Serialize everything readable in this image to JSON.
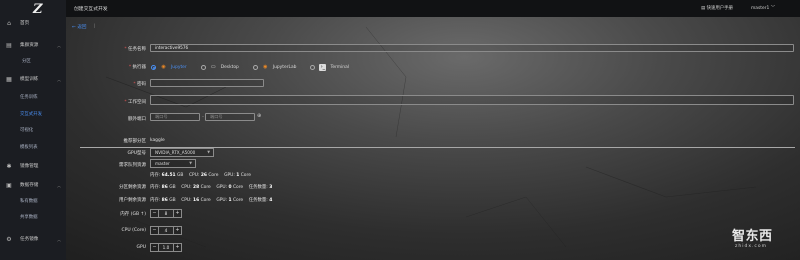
{
  "sidebar": {
    "logo": "Z",
    "items": [
      {
        "label": "首页",
        "icon": "home-icon"
      },
      {
        "label": "集群资源",
        "icon": "server-icon"
      },
      {
        "label": "分区",
        "icon": ""
      },
      {
        "label": "模型训练",
        "icon": "model-icon"
      },
      {
        "label": "任务训练",
        "icon": ""
      },
      {
        "label": "交互式开发",
        "icon": ""
      },
      {
        "label": "可视化",
        "icon": ""
      },
      {
        "label": "模板列表",
        "icon": ""
      },
      {
        "label": "镜像管理",
        "icon": "image-icon"
      },
      {
        "label": "数据存储",
        "icon": "storage-icon"
      },
      {
        "label": "私有数据",
        "icon": ""
      },
      {
        "label": "共享数据",
        "icon": ""
      },
      {
        "label": "任务镜像",
        "icon": "task-icon"
      }
    ]
  },
  "topbar": {
    "breadcrumb": "创建交互式开发",
    "manual_label": "快速用户手册",
    "user": "master1"
  },
  "form": {
    "back": "返回",
    "task_name_label": "任务名称",
    "task_name_value": "interactive9576",
    "executor_label": "执行器",
    "executors": [
      "Jupyter",
      "Desktop",
      "JupyterLab",
      "Terminal"
    ],
    "password_label": "密码",
    "workdir_label": "工作空间",
    "ports_label": "额外端口",
    "port_placeholder": "端口号",
    "partition_label": "推荐部分区",
    "partition_value": "kaggle",
    "gpu_type_label": "GPU型号",
    "gpu_type_value": "NVIDIA_RTX_A5000",
    "queue_label": "需求队列资源",
    "queue_value": "master",
    "res_line1": {
      "mem_label": "内存:",
      "mem": "64.51",
      "mem_unit": "GB",
      "cpu_label": "CPU:",
      "cpu": "26",
      "cpu_unit": "Core",
      "gpu_label": "GPU:",
      "gpu": "1",
      "gpu_unit": "Core"
    },
    "partition_quota_label": "分区剩余资源",
    "res_line2": {
      "mem_label": "内存:",
      "mem": "86",
      "mem_unit": "GB",
      "cpu_label": "CPU:",
      "cpu": "28",
      "cpu_unit": "Core",
      "gpu_label": "GPU:",
      "gpu": "0",
      "gpu_unit": "Core",
      "tasks_label": "任务数量:",
      "tasks": "3"
    },
    "user_quota_label": "用户剩余资源",
    "res_line3": {
      "mem_label": "内存:",
      "mem": "86",
      "mem_unit": "GB",
      "cpu_label": "CPU:",
      "cpu": "16",
      "cpu_unit": "Core",
      "gpu_label": "GPU:",
      "gpu": "1",
      "gpu_unit": "Core",
      "tasks_label": "任务数量:",
      "tasks": "4"
    },
    "mem_label": "内存 (GB ↑)",
    "mem_value": "8",
    "cpu_label": "CPU (Core)",
    "cpu_value": "4",
    "gpu_label": "GPU",
    "gpu_value": "1.0"
  },
  "watermark": {
    "text": "智东西",
    "sub": "zhidx.com"
  },
  "colors": {
    "accent": "#4a8ff2",
    "required": "#e25555",
    "sidebar": "#1b1d22",
    "topbar": "#111214"
  }
}
